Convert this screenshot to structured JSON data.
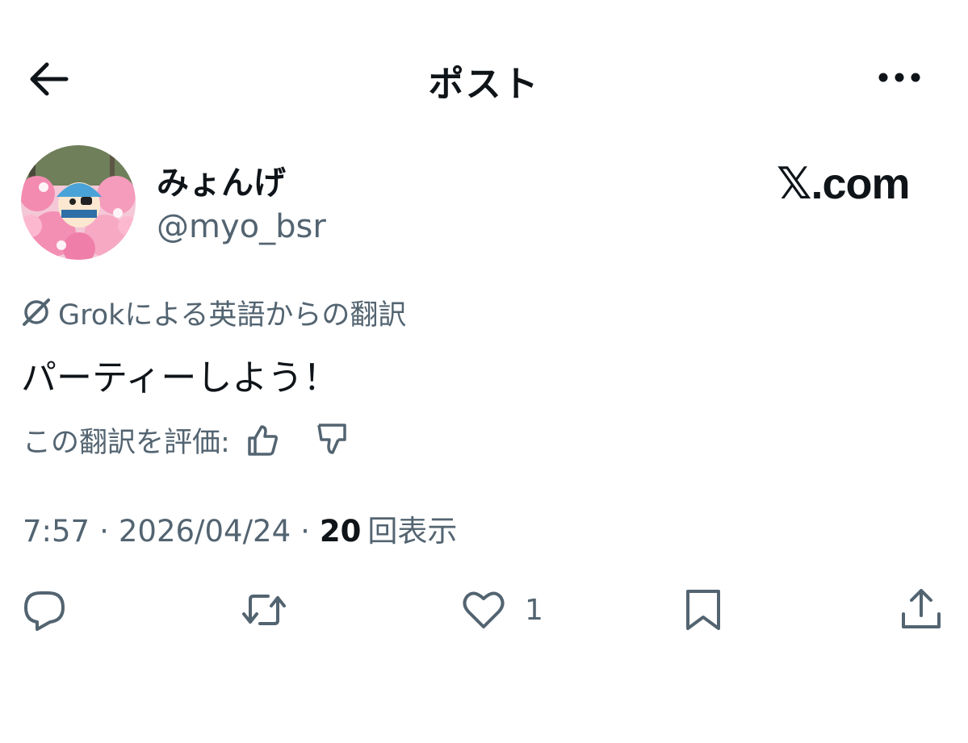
{
  "header": {
    "title": "ポスト",
    "back_icon": "arrow-left-icon",
    "more_icon": "more-horizontal-icon"
  },
  "author": {
    "display_name": "みょんげ",
    "handle": "@myo_bsr",
    "avatar_icon": "cherry-blossom-avatar"
  },
  "brand": {
    "label": "𝕏.com"
  },
  "translation": {
    "icon": "grok-icon",
    "label": "Grokによる英語からの翻訳"
  },
  "post": {
    "text": "パーティーしよう！"
  },
  "rating": {
    "label": "この翻訳を評価:",
    "up_icon": "thumbs-up-icon",
    "down_icon": "thumbs-down-icon"
  },
  "meta": {
    "time": "7:57",
    "separator": "·",
    "date": "2026/04/24",
    "views_count": "20",
    "views_label": "回表示"
  },
  "actions": {
    "reply_icon": "reply-icon",
    "repost_icon": "repost-icon",
    "like_icon": "heart-icon",
    "like_count": "1",
    "bookmark_icon": "bookmark-icon",
    "share_icon": "share-icon"
  },
  "colors": {
    "text_primary": "#0f1419",
    "text_secondary": "#536471",
    "background": "#ffffff"
  }
}
